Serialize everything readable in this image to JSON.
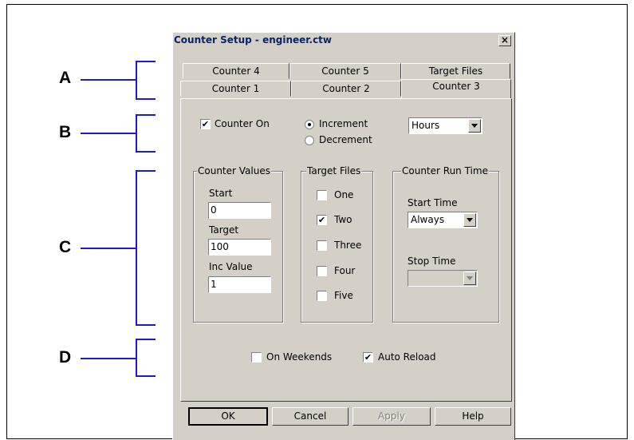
{
  "callouts": {
    "a": "A",
    "b": "B",
    "c": "C",
    "d": "D"
  },
  "dialog": {
    "title": "Counter Setup - engineer.ctw",
    "close_glyph": "×"
  },
  "tabs": {
    "back_row": [
      "Counter 4",
      "Counter 5",
      "Target Files"
    ],
    "front_row": [
      "Counter 1",
      "Counter 2",
      "Counter 3"
    ],
    "active": "Counter 3"
  },
  "counter_on": {
    "label": "Counter On",
    "checked": true
  },
  "direction": {
    "increment": "Increment",
    "decrement": "Decrement",
    "selected": "Increment"
  },
  "units": {
    "value": "Hours"
  },
  "counter_values": {
    "title": "Counter Values",
    "start_label": "Start",
    "start_value": "0",
    "target_label": "Target",
    "target_value": "100",
    "inc_label": "Inc Value",
    "inc_value": "1"
  },
  "target_files": {
    "title": "Target Files",
    "items": [
      {
        "label": "One",
        "checked": false
      },
      {
        "label": "Two",
        "checked": true
      },
      {
        "label": "Three",
        "checked": false
      },
      {
        "label": "Four",
        "checked": false
      },
      {
        "label": "Five",
        "checked": false
      }
    ]
  },
  "run_time": {
    "title": "Counter Run Time",
    "start_label": "Start Time",
    "start_value": "Always",
    "stop_label": "Stop Time",
    "stop_value": ""
  },
  "options": {
    "weekends": {
      "label": "On Weekends",
      "checked": false
    },
    "auto_reload": {
      "label": "Auto Reload",
      "checked": true
    }
  },
  "buttons": {
    "ok": "OK",
    "cancel": "Cancel",
    "apply": "Apply",
    "help": "Help"
  },
  "check_glyph": "✔"
}
